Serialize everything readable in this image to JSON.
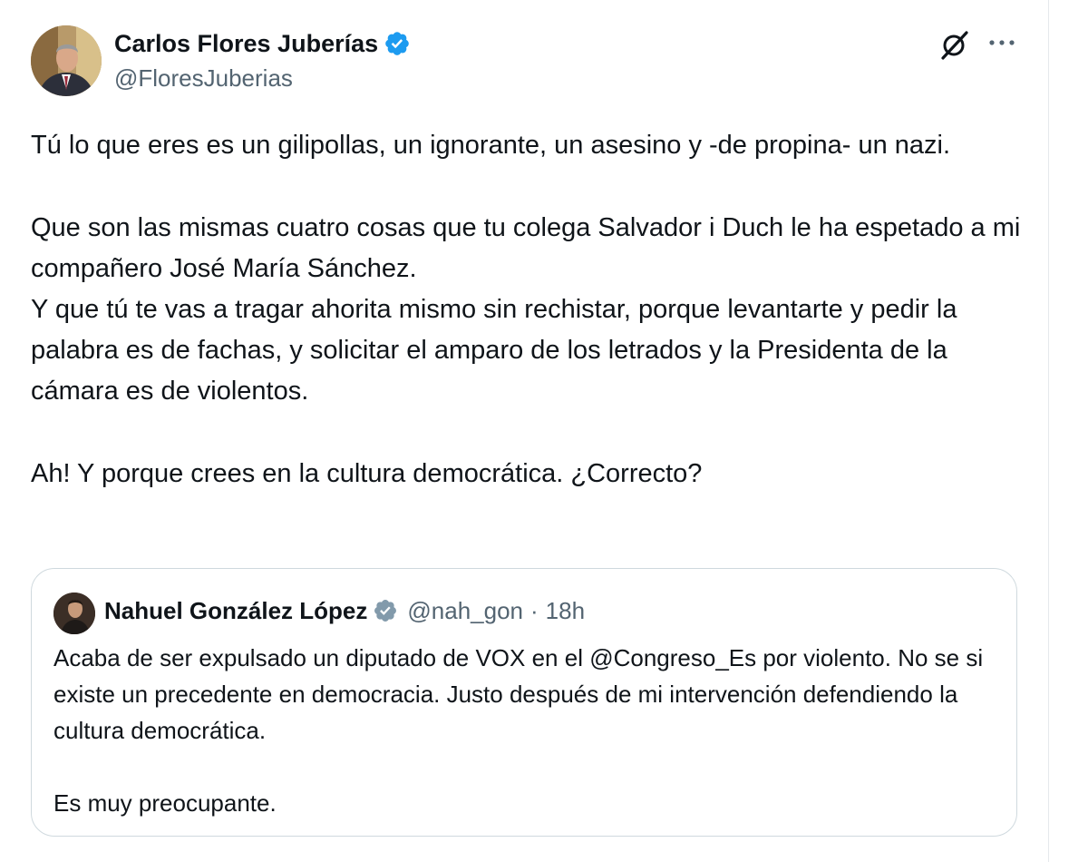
{
  "tweet": {
    "author": {
      "name": "Carlos Flores Juberías",
      "handle": "@FloresJuberias",
      "verified": true,
      "avatar_icon": "avatar"
    },
    "actions": {
      "grok_icon": "grok-icon",
      "more_icon": "more-icon"
    },
    "body": {
      "p1": "Tú lo que eres es un gilipollas, un ignorante, un asesino y -de propina- un nazi.",
      "p2": "Que son las mismas cuatro cosas que tu colega Salvador i Duch le ha espetado a mi compañero José María Sánchez.",
      "p3": "Y que tú te vas a tragar ahorita mismo sin rechistar, porque levantarte y pedir la palabra es de fachas, y solicitar el amparo de los letrados y la Presidenta de la cámara es de violentos.",
      "p4": "Ah! Y porque crees en la cultura democrática. ¿Correcto?"
    }
  },
  "quoted_tweet": {
    "author": {
      "name": "Nahuel González López",
      "handle": "@nah_gon",
      "verified": true
    },
    "separator": "·",
    "time": "18h",
    "body": {
      "p1": "Acaba de ser expulsado un diputado de VOX en el @Congreso_Es por violento. No se si existe un precedente en democracia. Justo después de mi intervención defendiendo la cultura democrática.",
      "p2": "Es muy preocupante."
    }
  },
  "colors": {
    "verified_blue": "#1d9bf0",
    "verified_gray": "#829aab",
    "text_primary": "#0f1419",
    "text_secondary": "#536471",
    "border": "#cfd9de"
  }
}
